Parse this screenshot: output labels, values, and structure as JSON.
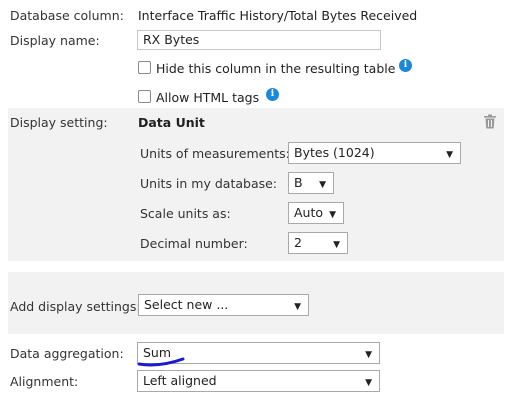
{
  "database_column": {
    "label": "Database column:",
    "value": "Interface Traffic History/Total Bytes Received"
  },
  "display_name": {
    "label": "Display name:",
    "value": "RX Bytes"
  },
  "hide_column": {
    "label": "Hide this column in the resulting table",
    "checked": false
  },
  "allow_html": {
    "label": "Allow HTML tags",
    "checked": false
  },
  "display_setting": {
    "label": "Display setting:",
    "title": "Data Unit",
    "units_measurement": {
      "label": "Units of measurements:",
      "value": "Bytes (1024)"
    },
    "units_database": {
      "label": "Units in my database:",
      "value": "B"
    },
    "scale_units": {
      "label": "Scale units as:",
      "value": "Auto"
    },
    "decimal_number": {
      "label": "Decimal number:",
      "value": "2"
    }
  },
  "add_display_settings": {
    "label": "Add display settings:",
    "value": "Select new ..."
  },
  "data_aggregation": {
    "label": "Data aggregation:",
    "value": "Sum"
  },
  "alignment": {
    "label": "Alignment:",
    "value": "Left aligned"
  },
  "icons": {
    "info": "info-icon",
    "trash": "trash-icon",
    "caret": "chevron-down-icon"
  },
  "colors": {
    "info_blue": "#1e88d8",
    "annotation_blue": "#1a1ad0",
    "panel_grey": "#f2f2f2"
  }
}
